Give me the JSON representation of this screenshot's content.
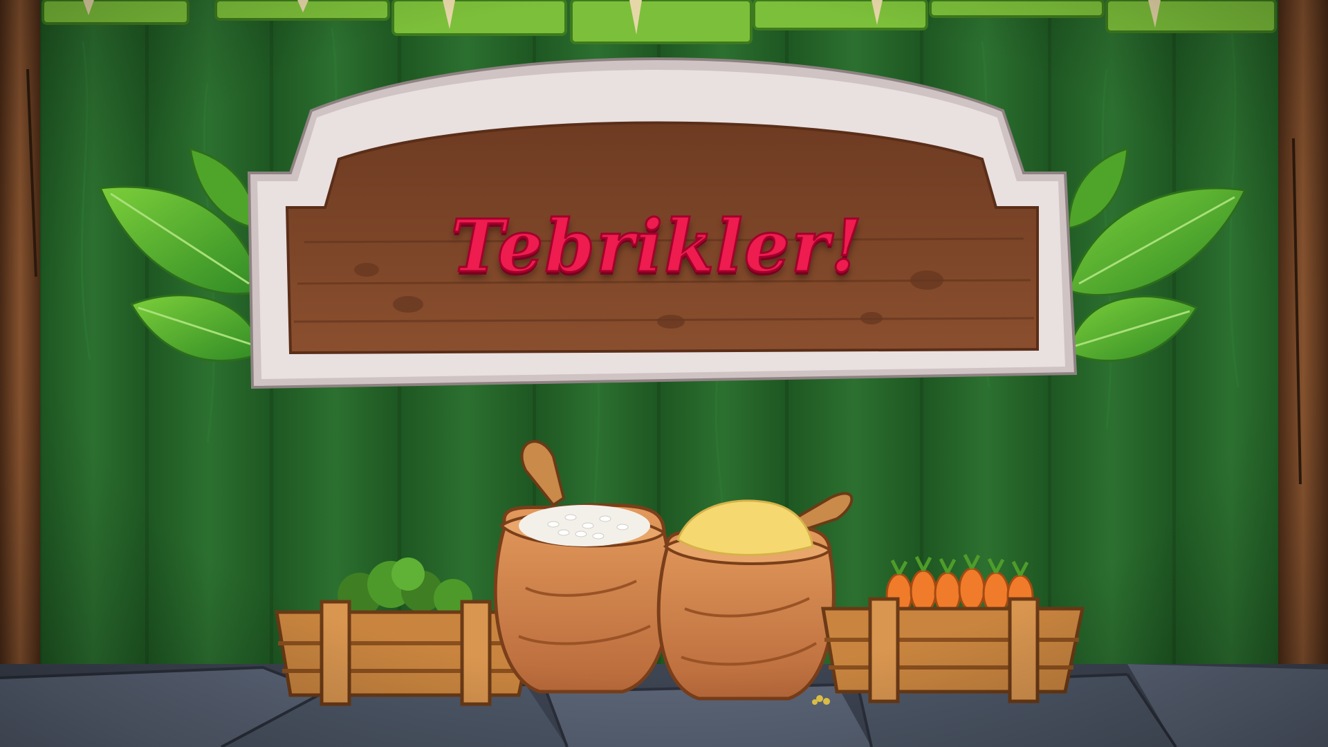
{
  "sign": {
    "title": "Tebrikler!"
  },
  "colors": {
    "wall_green": "#2a6b2c",
    "wall_dark": "#1b4d1e",
    "sign_frame": "#e6dcdc",
    "sign_wood": "#7a4428",
    "title_red": "#ee1c4f",
    "crate_wood": "#c9853f",
    "sack": "#d8894d",
    "floor": "#505a6a"
  },
  "icons": {
    "broccoli": "broccoli-icon",
    "rice_sack": "rice-sack-icon",
    "corn_flour_sack": "flour-sack-icon",
    "carrots": "carrot-icon"
  }
}
